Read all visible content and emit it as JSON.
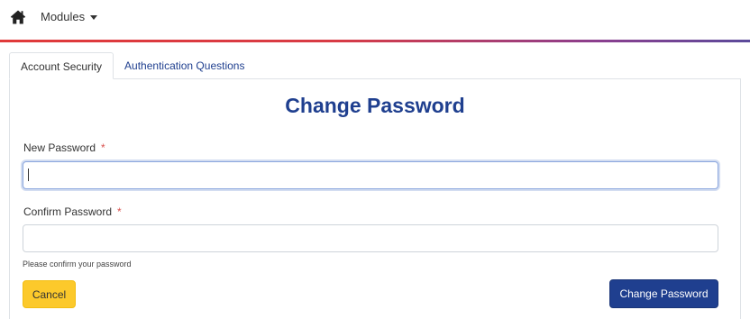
{
  "nav": {
    "home_icon": "home-icon",
    "modules_label": "Modules",
    "accent_colors": [
      "#e03a3a",
      "#8a3f8f",
      "#5b4a9a"
    ]
  },
  "tabs": [
    {
      "label": "Account Security",
      "active": true
    },
    {
      "label": "Authentication Questions",
      "active": false
    }
  ],
  "form": {
    "title": "Change Password",
    "new_password": {
      "label": "New Password",
      "required_mark": "*",
      "value": ""
    },
    "confirm_password": {
      "label": "Confirm Password",
      "required_mark": "*",
      "value": "",
      "help": "Please confirm your password"
    },
    "cancel_label": "Cancel",
    "submit_label": "Change Password"
  },
  "colors": {
    "primary": "#1f3f8f",
    "warning": "#fcc92b",
    "required": "#d9534f"
  }
}
